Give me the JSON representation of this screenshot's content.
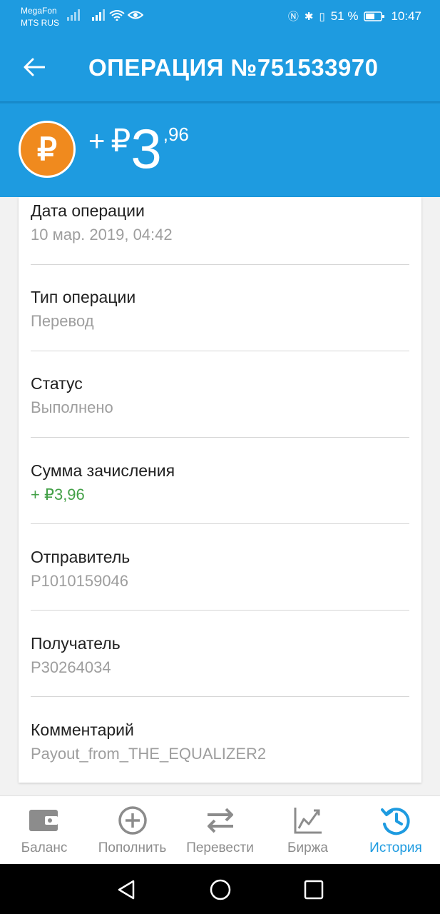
{
  "status_bar": {
    "carrier1": "MegaFon",
    "carrier2": "MTS RUS",
    "battery": "51 %",
    "time": "10:47"
  },
  "app_bar": {
    "title": "ОПЕРАЦИЯ №751533970",
    "back_icon": "arrow-back-icon"
  },
  "amount": {
    "sign": "+",
    "currency": "₽",
    "integer": "3",
    "decimal": ",96",
    "coin_symbol": "₽",
    "coin_color": "#f08a1e"
  },
  "details": [
    {
      "label": "Дата операции",
      "value": "10 мар. 2019, 04:42"
    },
    {
      "label": "Тип операции",
      "value": "Перевод"
    },
    {
      "label": "Статус",
      "value": "Выполнено"
    },
    {
      "label": "Сумма зачисления",
      "value": "+ ₽3,96"
    },
    {
      "label": "Отправитель",
      "value": "P1010159046"
    },
    {
      "label": "Получатель",
      "value": "P30264034"
    },
    {
      "label": "Комментарий",
      "value": "Payout_from_THE_EQUALIZER2"
    }
  ],
  "bottom_nav": [
    {
      "label": "Баланс",
      "icon": "wallet-icon"
    },
    {
      "label": "Пополнить",
      "icon": "plus-circle-icon"
    },
    {
      "label": "Перевести",
      "icon": "transfer-arrows-icon"
    },
    {
      "label": "Биржа",
      "icon": "chart-icon"
    },
    {
      "label": "История",
      "icon": "history-icon",
      "active": true
    }
  ],
  "colors": {
    "primary": "#1e9be0",
    "accent_green": "#43a047",
    "muted": "#9e9e9e"
  }
}
